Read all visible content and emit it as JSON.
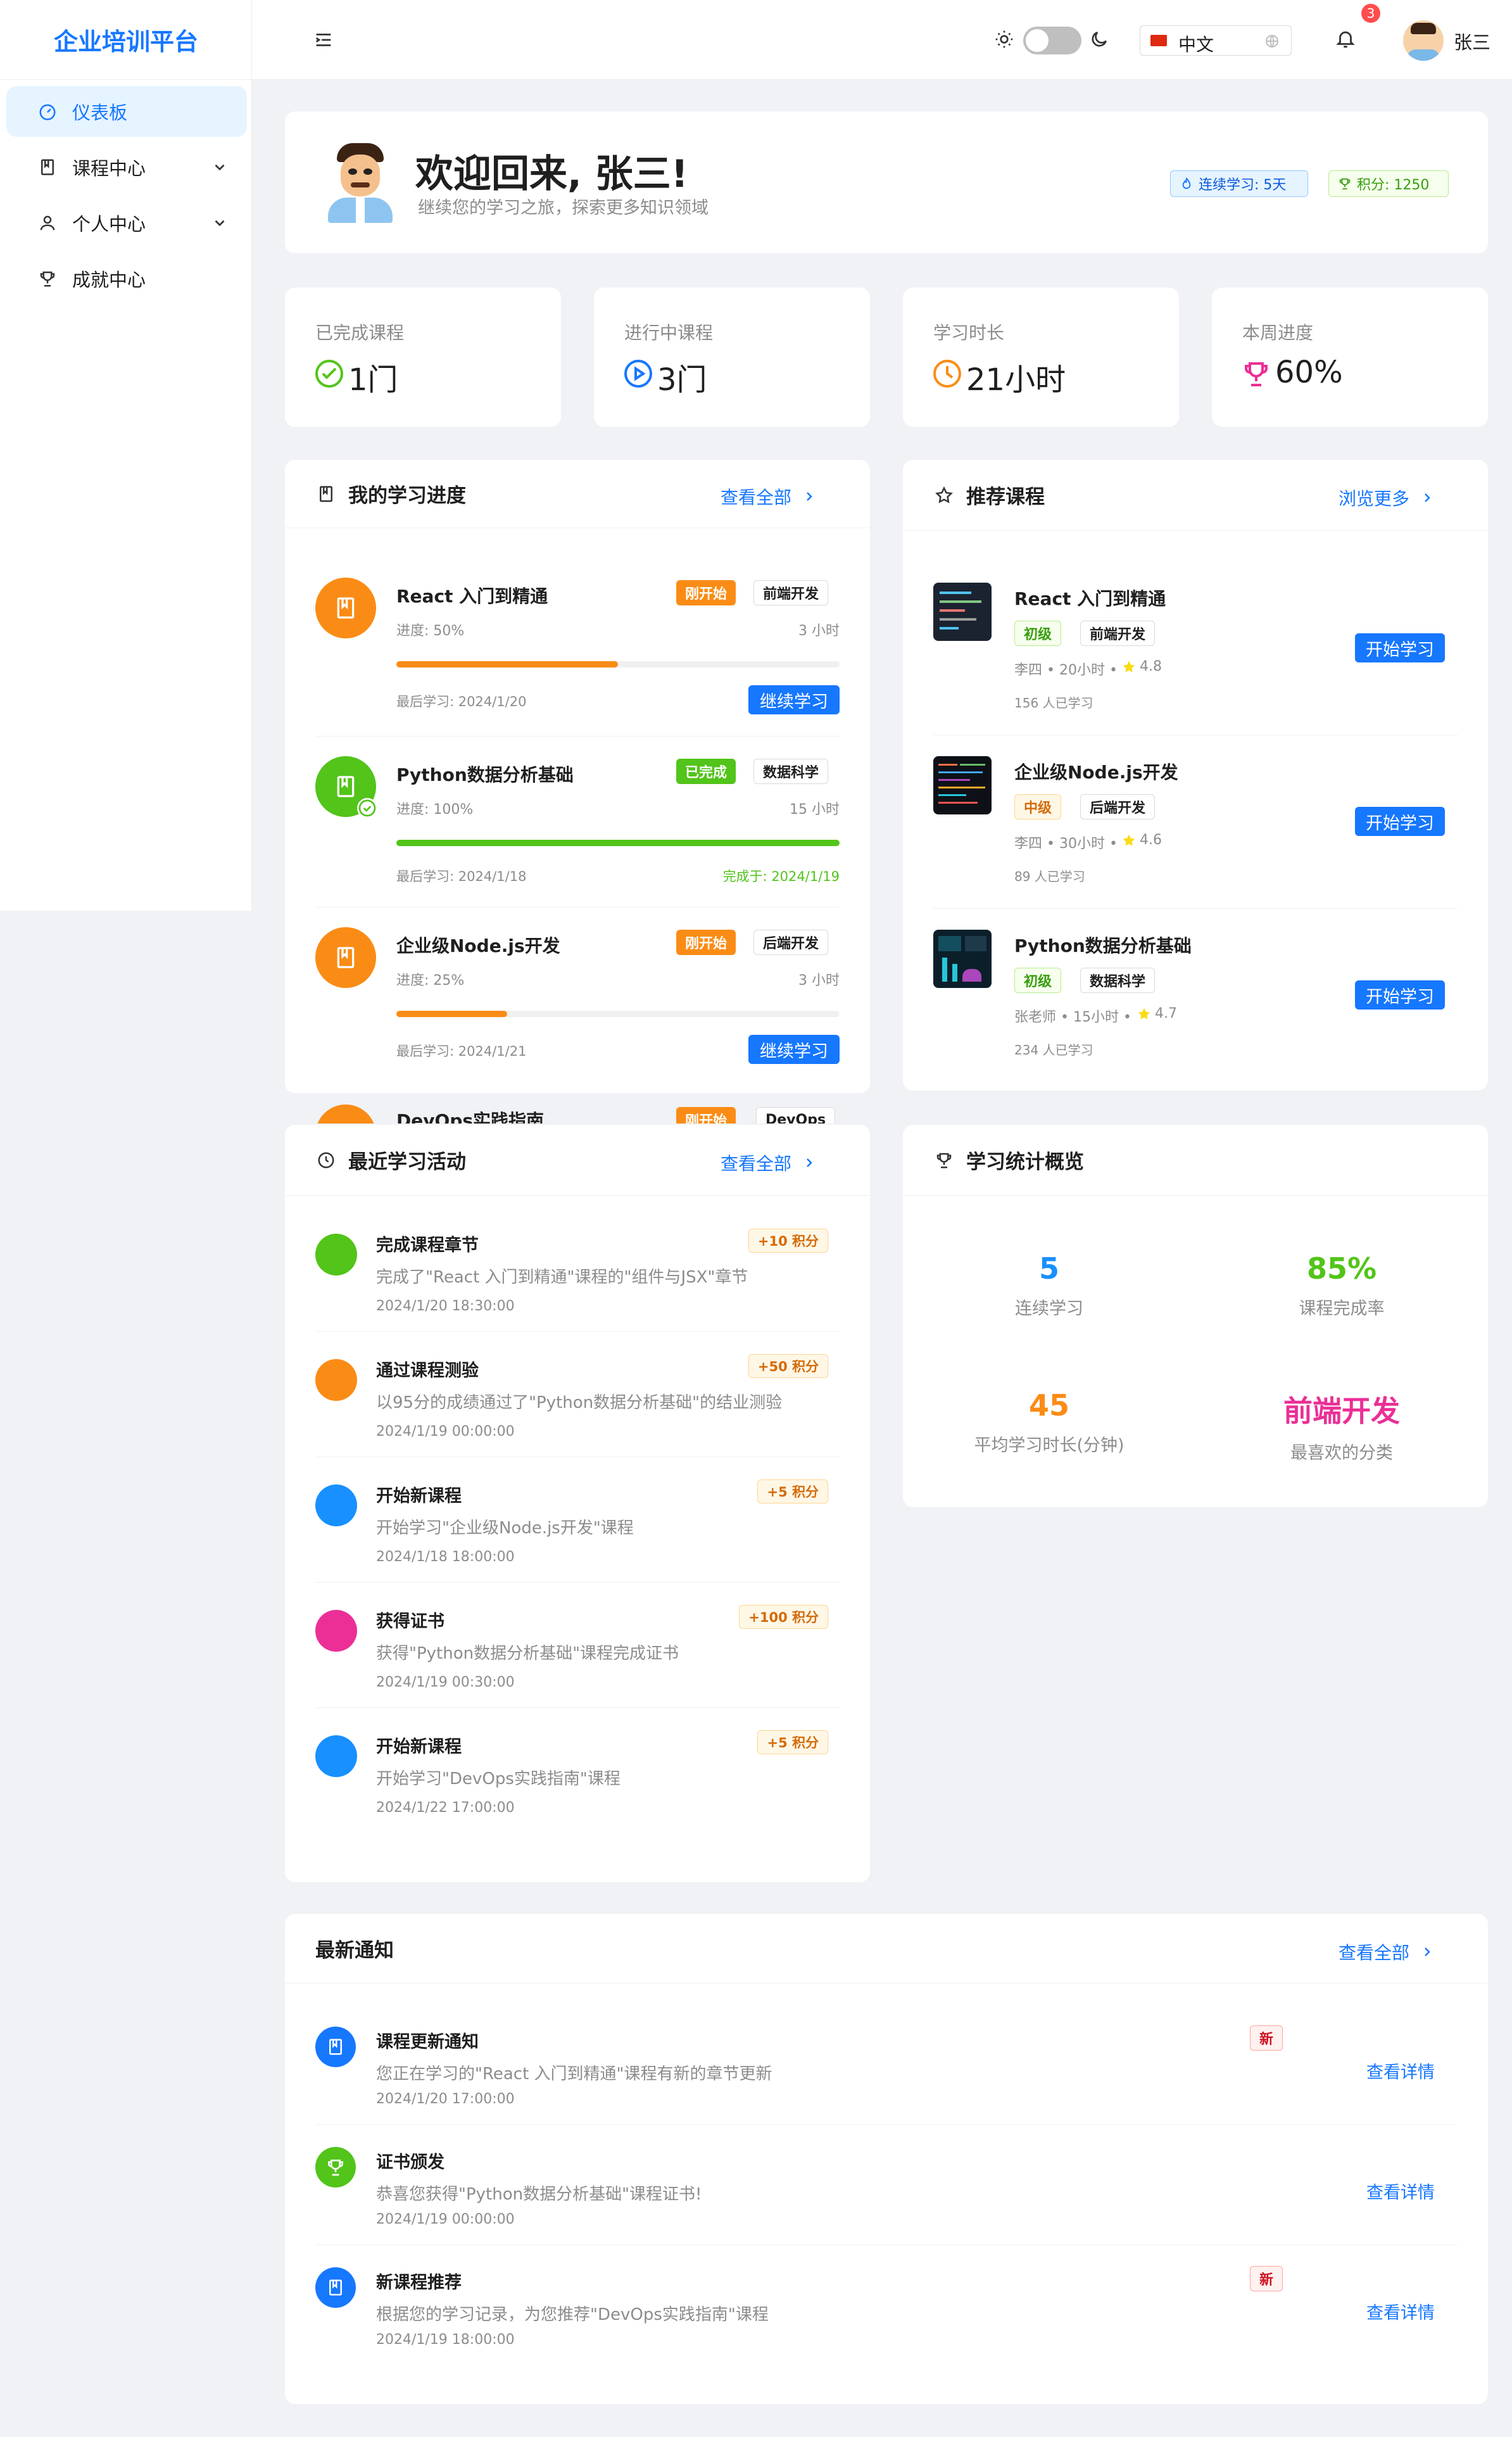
{
  "app": {
    "title": "企业培训平台"
  },
  "sidebar": {
    "items": [
      {
        "label": "仪表板"
      },
      {
        "label": "课程中心"
      },
      {
        "label": "个人中心"
      },
      {
        "label": "成就中心"
      }
    ]
  },
  "header": {
    "language": "中文",
    "notification_count": "3",
    "user_name": "张三"
  },
  "welcome": {
    "title": "欢迎回来, 张三!",
    "subtitle": "继续您的学习之旅，探索更多知识领域",
    "streak_badge": "连续学习: 5天",
    "points_badge": "积分: 1250"
  },
  "stats": [
    {
      "label": "已完成课程",
      "value": "1门"
    },
    {
      "label": "进行中课程",
      "value": "3门"
    },
    {
      "label": "学习时长",
      "value": "21小时"
    },
    {
      "label": "本周进度",
      "value": "60%"
    }
  ],
  "progress": {
    "title": "我的学习进度",
    "view_all": "查看全部",
    "items": [
      {
        "name": "React 入门到精通",
        "status": "刚开始",
        "category": "前端开发",
        "progress_label": "进度: 50%",
        "progress": 0.5,
        "hours": "3 小时",
        "last": "最后学习: 2024/1/20",
        "action": "继续学习"
      },
      {
        "name": "Python数据分析基础",
        "status": "已完成",
        "category": "数据科学",
        "progress_label": "进度: 100%",
        "progress": 1.0,
        "hours": "15 小时",
        "last": "最后学习: 2024/1/18",
        "action": "完成于: 2024/1/19"
      },
      {
        "name": "企业级Node.js开发",
        "status": "刚开始",
        "category": "后端开发",
        "progress_label": "进度: 25%",
        "progress": 0.25,
        "hours": "3 小时",
        "last": "最后学习: 2024/1/21",
        "action": "继续学习"
      },
      {
        "name": "DevOps实践指南",
        "status": "刚开始",
        "category": "DevOps"
      }
    ]
  },
  "recommended": {
    "title": "推荐课程",
    "browse_more": "浏览更多",
    "items": [
      {
        "name": "React 入门到精通",
        "level": "初级",
        "category": "前端开发",
        "meta": "李四 • 20小时 •",
        "rating": "4.8",
        "learners": "156 人已学习",
        "action": "开始学习"
      },
      {
        "name": "企业级Node.js开发",
        "level": "中级",
        "category": "后端开发",
        "meta": "李四 • 30小时 •",
        "rating": "4.6",
        "learners": "89 人已学习",
        "action": "开始学习"
      },
      {
        "name": "Python数据分析基础",
        "level": "初级",
        "category": "数据科学",
        "meta": "张老师 • 15小时 •",
        "rating": "4.7",
        "learners": "234 人已学习",
        "action": "开始学习"
      }
    ]
  },
  "activity": {
    "title": "最近学习活动",
    "view_all": "查看全部",
    "items": [
      {
        "title": "完成课程章节",
        "points": "+10 积分",
        "desc": "完成了\"React 入门到精通\"课程的\"组件与JSX\"章节",
        "time": "2024/1/20 18:30:00",
        "color": "#52c41a"
      },
      {
        "title": "通过课程测验",
        "points": "+50 积分",
        "desc": "以95分的成绩通过了\"Python数据分析基础\"的结业测验",
        "time": "2024/1/19 00:00:00",
        "color": "#fa8c16"
      },
      {
        "title": "开始新课程",
        "points": "+5 积分",
        "desc": "开始学习\"企业级Node.js开发\"课程",
        "time": "2024/1/18 18:00:00",
        "color": "#1890ff"
      },
      {
        "title": "获得证书",
        "points": "+100 积分",
        "desc": "获得\"Python数据分析基础\"课程完成证书",
        "time": "2024/1/19 00:30:00",
        "color": "#eb2f96"
      },
      {
        "title": "开始新课程",
        "points": "+5 积分",
        "desc": "开始学习\"DevOps实践指南\"课程",
        "time": "2024/1/22 17:00:00",
        "color": "#1890ff"
      }
    ]
  },
  "summary": {
    "title": "学习统计概览",
    "items": [
      {
        "value": "5",
        "label": "连续学习",
        "color": "#1890ff"
      },
      {
        "value": "85%",
        "label": "课程完成率",
        "color": "#52c41a"
      },
      {
        "value": "45",
        "label": "平均学习时长(分钟)",
        "color": "#fa8c16"
      },
      {
        "value": "前端开发",
        "label": "最喜欢的分类",
        "color": "#eb2f96"
      }
    ]
  },
  "notices": {
    "title": "最新通知",
    "view_all": "查看全部",
    "items": [
      {
        "title": "课程更新通知",
        "desc": "您正在学习的\"React 入门到精通\"课程有新的章节更新",
        "time": "2024/1/20 17:00:00",
        "badge": "新",
        "action": "查看详情",
        "color": "#1677ff"
      },
      {
        "title": "证书颁发",
        "desc": "恭喜您获得\"Python数据分析基础\"课程证书!",
        "time": "2024/1/19 00:00:00",
        "badge": "",
        "action": "查看详情",
        "color": "#52c41a"
      },
      {
        "title": "新课程推荐",
        "desc": "根据您的学习记录，为您推荐\"DevOps实践指南\"课程",
        "time": "2024/1/19 18:00:00",
        "badge": "新",
        "action": "查看详情",
        "color": "#1677ff"
      }
    ]
  }
}
